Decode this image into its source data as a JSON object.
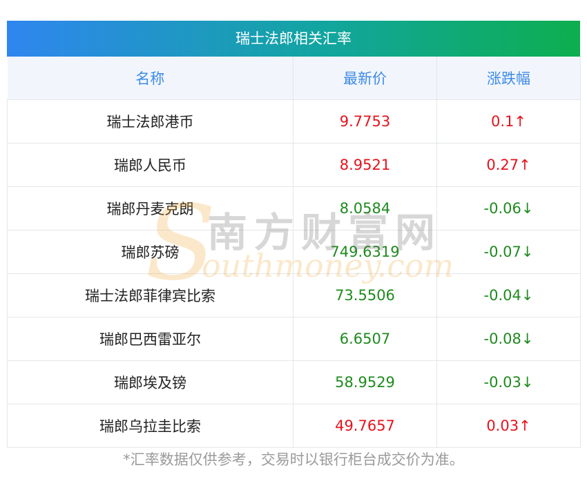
{
  "table": {
    "title": "瑞士法郎相关汇率",
    "headers": [
      "名称",
      "最新价",
      "涨跌幅"
    ],
    "rows": [
      {
        "name": "瑞士法郎港币",
        "price": "9.7753",
        "change": "0.1↑",
        "trend": "up"
      },
      {
        "name": "瑞郎人民币",
        "price": "8.9521",
        "change": "0.27↑",
        "trend": "up"
      },
      {
        "name": "瑞郎丹麦克朗",
        "price": "8.0584",
        "change": "-0.06↓",
        "trend": "down"
      },
      {
        "name": "瑞郎苏磅",
        "price": "749.6319",
        "change": "-0.07↓",
        "trend": "down"
      },
      {
        "name": "瑞士法郎菲律宾比索",
        "price": "73.5506",
        "change": "-0.04↓",
        "trend": "down"
      },
      {
        "name": "瑞郎巴西雷亚尔",
        "price": "6.6507",
        "change": "-0.08↓",
        "trend": "down"
      },
      {
        "name": "瑞郎埃及镑",
        "price": "58.9529",
        "change": "-0.03↓",
        "trend": "down"
      },
      {
        "name": "瑞郎乌拉圭比索",
        "price": "49.7657",
        "change": "0.03↑",
        "trend": "up"
      }
    ]
  },
  "footer": "*汇率数据仅供参考，交易时以银行柜台成交价为准。",
  "watermark": {
    "letter": "S",
    "cn": "南方财富网",
    "en": "outhmoney.com"
  },
  "colors": {
    "up": "#e6121c",
    "down": "#1e8a1e",
    "header_text": "#3d8ae6"
  }
}
